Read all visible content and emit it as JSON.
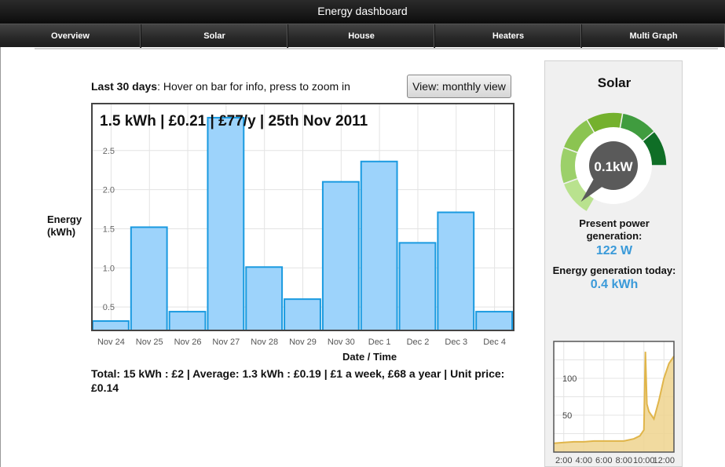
{
  "header": {
    "title": "Energy dashboard"
  },
  "nav": {
    "tabs": [
      {
        "label": "Overview"
      },
      {
        "label": "Solar"
      },
      {
        "label": "House"
      },
      {
        "label": "Heaters"
      },
      {
        "label": "Multi Graph"
      }
    ]
  },
  "chart_section": {
    "caption_bold": "Last 30 days",
    "caption_rest": ": Hover on bar for info, press to zoom in",
    "view_button": "View: monthly view",
    "ylabel_line1": "Energy",
    "ylabel_line2": "(kWh)",
    "xlabel": "Date / Time",
    "totals": "Total: 15 kWh : £2 | Average: 1.3 kWh : £0.19 | £1 a week, £68 a year | Unit price: £0.14"
  },
  "chart_data": {
    "type": "bar",
    "hover_info": "1.5 kWh | £0.21 | £77/y | 25th Nov 2011",
    "categories": [
      "Nov 24",
      "Nov 25",
      "Nov 26",
      "Nov 27",
      "Nov 28",
      "Nov 29",
      "Nov 30",
      "Dec 1",
      "Dec 2",
      "Dec 3",
      "Dec 4"
    ],
    "values": [
      0.32,
      1.52,
      0.44,
      2.92,
      1.01,
      0.6,
      2.1,
      2.36,
      1.32,
      1.71,
      0.44
    ],
    "yticks": [
      "0.5",
      "1.0",
      "1.5",
      "2.0",
      "2.5"
    ],
    "ylim": [
      0.2,
      3.1
    ],
    "bar_fill": "#9dd3fb",
    "bar_stroke": "#1a9ae0",
    "grid": true
  },
  "solar": {
    "title": "Solar",
    "gauge": {
      "value_label": "0.1kW",
      "segment_colors": [
        "#b9e28e",
        "#9cd06a",
        "#8bc451",
        "#74b12d",
        "#409c3f",
        "#0f6e26"
      ],
      "needle_fraction": 0.05
    },
    "present_label_line1": "Present power",
    "present_label_line2": "generation:",
    "present_value": "122 W",
    "energy_today_label": "Energy generation today:",
    "energy_today_value": "0.4 kWh"
  },
  "mini_chart": {
    "yticks": [
      "50",
      "100"
    ],
    "xticks": [
      "2:00",
      "4:00",
      "6:00",
      "8:00",
      "10:00",
      "12:00"
    ],
    "ylim": [
      0,
      150
    ],
    "xlim": [
      1,
      13
    ],
    "x": [
      1,
      2,
      3,
      4,
      5,
      6,
      7,
      8,
      9,
      9.6,
      10,
      10.15,
      10.3,
      10.5,
      11,
      11.5,
      12,
      12.5,
      13
    ],
    "y": [
      12,
      13,
      14,
      14,
      15,
      15,
      15,
      15,
      18,
      22,
      30,
      136,
      65,
      55,
      45,
      70,
      100,
      120,
      130
    ],
    "line_color": "#e0b54a",
    "fill_color": "#efd48e"
  }
}
